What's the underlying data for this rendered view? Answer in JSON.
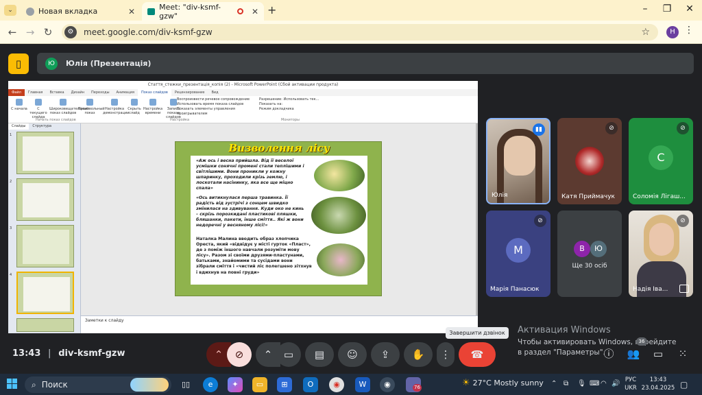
{
  "browser": {
    "tabs": [
      {
        "label": "Новая вкладка",
        "icon": "chrome-icon"
      },
      {
        "label": "Meet: \"div-ksmf-gzw\"",
        "icon": "meet-icon",
        "recording": true
      }
    ],
    "url": "meet.google.com/div-ksmf-gzw",
    "profile_initial": "H"
  },
  "meet": {
    "presenter": {
      "initial": "Ю",
      "label": "Юлія (Презентація)"
    },
    "time": "13:43",
    "meeting_code": "div-ksmf-gzw",
    "end_call_tooltip": "Завершити дзвінок",
    "people_count": "36",
    "participants": [
      {
        "name": "Юлія",
        "type": "video",
        "speaking": true
      },
      {
        "name": "Катя Приймачук",
        "type": "image",
        "muted": true
      },
      {
        "name": "Соломія Лігаш...",
        "initial": "С",
        "color": "#2e7d32",
        "muted": true
      },
      {
        "name": "Марія Панасюк",
        "initial": "М",
        "color": "#5c6bc0",
        "muted": true
      },
      {
        "name": "Ще 30 осіб",
        "type": "more",
        "initials": [
          "В",
          "Ю"
        ],
        "colors": [
          "#8e24aa",
          "#546e7a"
        ]
      },
      {
        "name": "Надія Іва...",
        "type": "video",
        "muted": true
      }
    ]
  },
  "ppt": {
    "window_title": "Стаття_стежки_презентація_копія (2) - Microsoft PowerPoint (Сбой активации продукта)",
    "tabs": [
      "Файл",
      "Главная",
      "Вставка",
      "Дизайн",
      "Переходы",
      "Анимация",
      "Показ слайдов",
      "Рецензирование",
      "Вид"
    ],
    "ribbon_items": [
      "С начала",
      "С текущего слайда",
      "Широковещательный показ слайдов",
      "Произвольный показ",
      "Настройка демонстрации",
      "Скрыть слайд",
      "Настройка времени",
      "Запись показа слайдов"
    ],
    "ribbon_checks": [
      "Воспроизвести речевое сопровождение",
      "Использовать время показа слайдов",
      "Показать элементы управления проигрывателем"
    ],
    "ribbon_checks2": [
      "Разрешение: Использовать тек...",
      "Показать на:",
      "Режим докладчика"
    ],
    "ribbon_groups": [
      "Начать показ слайдов",
      "Настройка",
      "Мониторы"
    ],
    "panel_tabs": [
      "Слайды",
      "Структура"
    ],
    "slide_numbers": [
      "1",
      "2",
      "3",
      "4"
    ],
    "notes_placeholder": "Заметки к слайду",
    "slide": {
      "title": "Визволення лісу",
      "p1": "«Аж ось і весна прийшла. Від її веселої усмішки сонячні промені стали теплішими і світлішими. Вони проникли у кожну шпаринку, проходили крізь землю, і лоскотали насінинку, яка все ще міцно спала»",
      "p2": "«Ось витикнулася перша травинка. Її радість від зустрічі з сонцем швидко змінилася на здивування. Куди око не кинь – скрізь порозкидані пластикові пляшки, бляшанки, пакети, інше сміття.. Які ж вони недоречні у весняному лісі!»",
      "p3": "Наталка Малина вводить образ хлопчика Ореста, який «відвідує у місті гурток «Пласт», де з поміж іншого навчали розуміти мову лісу». Разом зі своїми друзями-пластунами, батьками, знайомими та сусідами вони зібрали сміття і «чистий ліс полегшено зітхнув і вдихнув на повні груди»"
    }
  },
  "windows": {
    "watermark_title": "Активация Windows",
    "watermark_text": "Чтобы активировать Windows, перейдите в раздел \"Параметры\".",
    "search_placeholder": "Поиск",
    "weather": "27°C  Mostly sunny",
    "lang1": "РУС",
    "lang2": "UKR",
    "time": "13:43",
    "date": "23.04.2025",
    "teams_badge": "76"
  },
  "colors": {
    "end_call": "#ea4335",
    "mic_off": "#f9dedc",
    "meet_bg": "#202124"
  }
}
